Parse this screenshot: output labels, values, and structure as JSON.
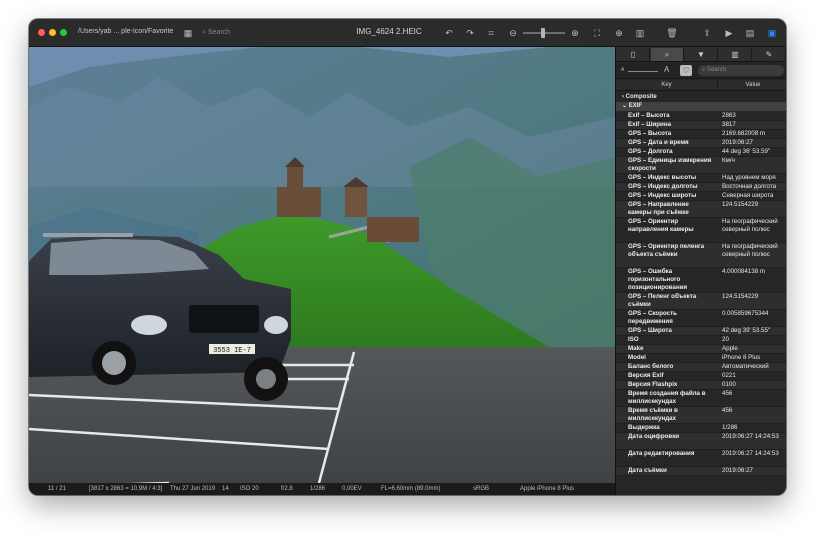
{
  "window": {
    "path": "/Users/yab ... ple-Icon/Favorite",
    "title": "IMG_4624 2.HEIC",
    "search_placeholder": "Search"
  },
  "icons": {
    "grid": "▦",
    "search": "⌕",
    "rotate_left": "↶",
    "rotate_right": "↷",
    "crop": "⌗",
    "zoom_out": "⊖",
    "zoom_in": "⊕",
    "fit": "⛶",
    "split": "▥",
    "zoom2": "⊕",
    "trash": "🗑",
    "share": "⇪",
    "slideshow": "▶",
    "sidebar_left": "▤",
    "sidebar_right": "▣"
  },
  "image": {
    "plate": "3553 ΙΕ-7"
  },
  "status": {
    "counter": "11 / 21",
    "dims": "[3817 x 2863 = 10,9M / 4:3]",
    "date": "Thu 27 Jun 2019",
    "num": "14",
    "iso": "ISO 20",
    "aperture": "f/2.8",
    "shutter": "1/286",
    "ev": "0,00EV",
    "focal": "FL=6,60mm (89.0mm)",
    "color": "sRGB",
    "camera": "Apple iPhone 8 Plus"
  },
  "inspector": {
    "tabs": [
      "▯",
      "⌕",
      "▼",
      "▥",
      "✎"
    ],
    "font_small": "A",
    "font_large": "A",
    "heart": "♡",
    "search_placeholder": "Search",
    "col_key": "Key",
    "col_value": "Value",
    "group_composite": "Composite",
    "group_exif": "EXIF",
    "rows": [
      {
        "k": "Exif – Высота",
        "v": "2863",
        "h": 9
      },
      {
        "k": "Exif – Ширина",
        "v": "3817",
        "h": 9
      },
      {
        "k": "GPS – Высота",
        "v": "2169.682008 m",
        "h": 9
      },
      {
        "k": "GPS – Дата и время",
        "v": "2019:06:27",
        "h": 9
      },
      {
        "k": "GPS – Долгота",
        "v": "44 deg 36' 53.59\"",
        "h": 9
      },
      {
        "k": "GPS – Единицы измерения скорости",
        "v": "Км/ч",
        "h": 17
      },
      {
        "k": "GPS – Индекс высоты",
        "v": "Над уровнем моря",
        "h": 9
      },
      {
        "k": "GPS – Индекс долготы",
        "v": "Восточная долгота",
        "h": 9
      },
      {
        "k": "GPS – Индекс широты",
        "v": "Северная широта",
        "h": 9
      },
      {
        "k": "GPS – Направление камеры при съёмке",
        "v": "124.5154229",
        "h": 17
      },
      {
        "k": "GPS – Ориентир направления камеры",
        "v": "На географический северный полюс",
        "h": 25
      },
      {
        "k": "GPS – Ориентир пеленга объекта съёмки",
        "v": "На географический северный полюс",
        "h": 25
      },
      {
        "k": "GPS – Ошибка горизонтального позиционирования",
        "v": "4.000084138 m",
        "h": 25
      },
      {
        "k": "GPS – Пеленг объекта съёмки",
        "v": "124.5154229",
        "h": 17
      },
      {
        "k": "GPS – Скорость передвижения",
        "v": "0.005859675344",
        "h": 17
      },
      {
        "k": "GPS – Широта",
        "v": "42 deg 39' 53.55\"",
        "h": 9
      },
      {
        "k": "ISO",
        "v": "20",
        "h": 9
      },
      {
        "k": "Make",
        "v": "Apple",
        "h": 9
      },
      {
        "k": "Model",
        "v": "iPhone 8 Plus",
        "h": 9
      },
      {
        "k": "Баланс белого",
        "v": "Автоматический",
        "h": 9
      },
      {
        "k": "Версия Exif",
        "v": "0221",
        "h": 9
      },
      {
        "k": "Версия Flashpix",
        "v": "0100",
        "h": 9
      },
      {
        "k": "Время создания файла в миллисекундах",
        "v": "456",
        "h": 17
      },
      {
        "k": "Время съёмки в миллисекундах",
        "v": "456",
        "h": 17
      },
      {
        "k": "Выдержка",
        "v": "1/286",
        "h": 9
      },
      {
        "k": "Дата оцифровки",
        "v": "2019:06:27 14:24:53",
        "h": 17
      },
      {
        "k": "Дата редактирования",
        "v": "2019:06:27 14:24:53",
        "h": 17
      },
      {
        "k": "Дата съёмки",
        "v": "2019:06:27",
        "h": 9
      }
    ]
  }
}
